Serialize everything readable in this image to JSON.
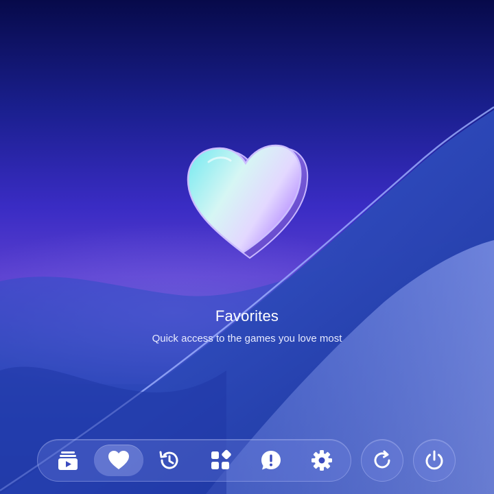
{
  "hero": {
    "title": "Favorites",
    "subtitle": "Quick access to the games you love most",
    "illustration": "heart-icon"
  },
  "dock": {
    "items": [
      {
        "name": "library",
        "icon": "library-play-icon",
        "active": false
      },
      {
        "name": "favorites",
        "icon": "heart-icon",
        "active": true
      },
      {
        "name": "history",
        "icon": "history-icon",
        "active": false
      },
      {
        "name": "apps",
        "icon": "apps-grid-icon",
        "active": false
      },
      {
        "name": "feedback",
        "icon": "alert-bubble-icon",
        "active": false
      },
      {
        "name": "settings",
        "icon": "gear-icon",
        "active": false
      }
    ]
  },
  "actions": [
    {
      "name": "refresh",
      "icon": "refresh-icon"
    },
    {
      "name": "power",
      "icon": "power-icon"
    }
  ],
  "colors": {
    "background_top": "#070a4a",
    "background_mid": "#3a2cc4",
    "background_bottom": "#1a2f8f",
    "text": "#ffffff",
    "heart_cyan": "#7ff0f0",
    "heart_violet": "#b79cff"
  }
}
